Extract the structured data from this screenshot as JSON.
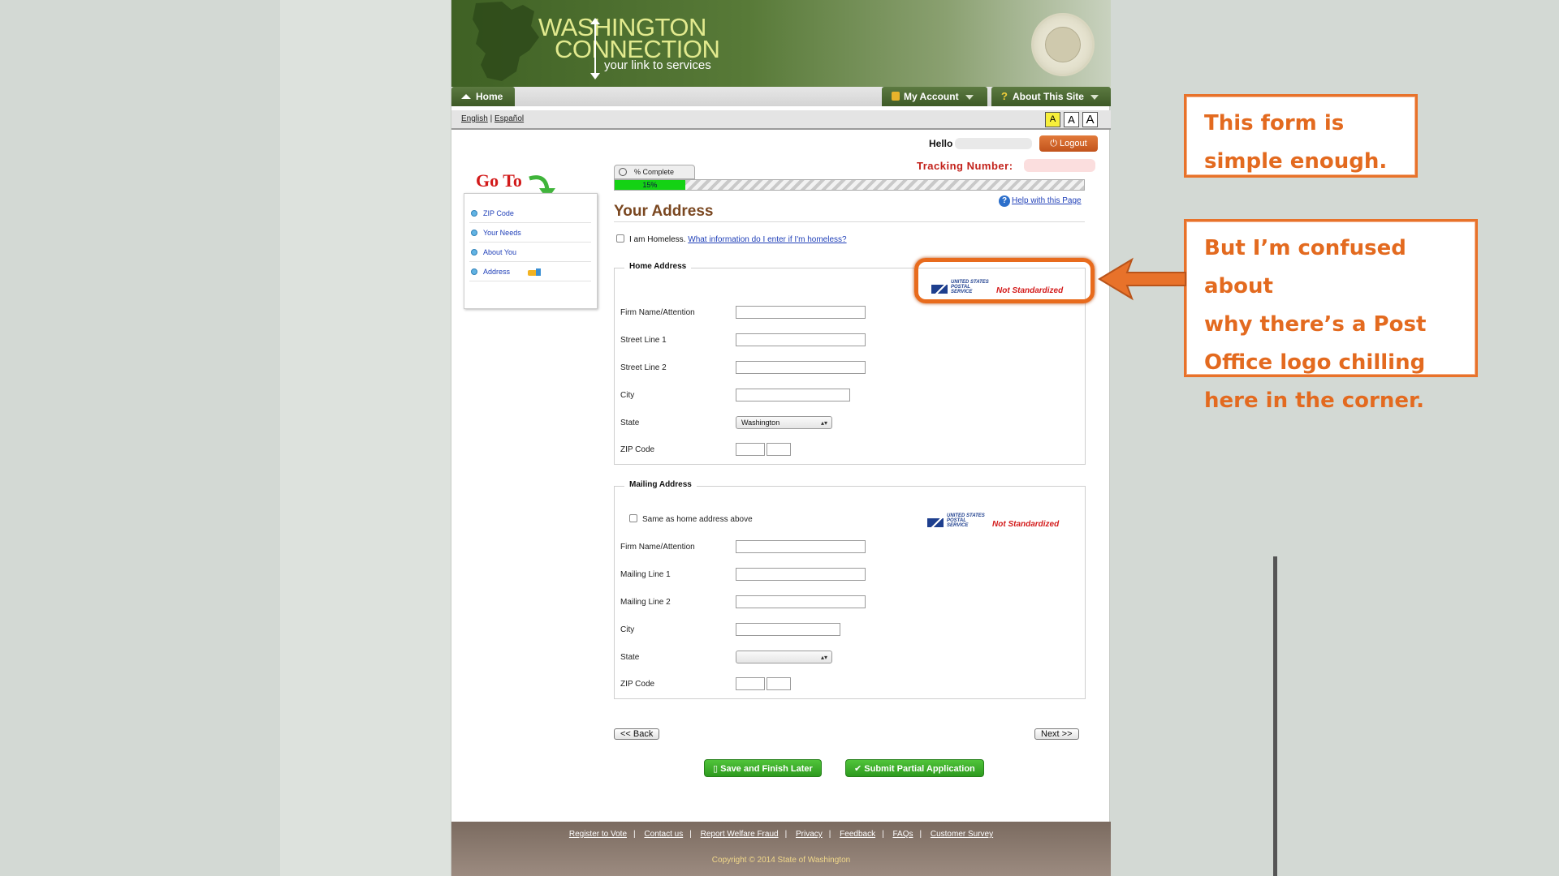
{
  "header": {
    "logo_line1": "WASHINGTON",
    "logo_line2": "CONNECTION",
    "tagline": "your link to services"
  },
  "nav": {
    "home": "Home",
    "my_account": "My Account",
    "about_site": "About This Site"
  },
  "language": {
    "english": "English",
    "separator": "|",
    "espanol": "Español"
  },
  "font_size_buttons": [
    "A",
    "A",
    "A"
  ],
  "user": {
    "hello": "Hello",
    "logout": "Logout",
    "tracking_label": "Tracking Number:"
  },
  "progress": {
    "label": "% Complete",
    "value_text": "15%",
    "value": 0.15
  },
  "sidebar": {
    "goto": "Go To",
    "items": [
      {
        "label": "ZIP Code"
      },
      {
        "label": "Your Needs"
      },
      {
        "label": "About You"
      },
      {
        "label": "Address"
      }
    ]
  },
  "page": {
    "title": "Your Address",
    "help_link": "Help with this Page",
    "homeless_label": "I am Homeless.",
    "homeless_link": "What information do I enter if I'm homeless?"
  },
  "home_address": {
    "legend": "Home Address",
    "usps_label": "UNITED STATES POSTAL SERVICE",
    "status": "Not Standardized",
    "fields": [
      {
        "label": "Firm Name/Attention",
        "value": ""
      },
      {
        "label": "Street Line 1",
        "value": ""
      },
      {
        "label": "Street Line 2",
        "value": ""
      },
      {
        "label": "City",
        "value": ""
      },
      {
        "label": "State",
        "value": "Washington"
      },
      {
        "label": "ZIP Code",
        "value": ""
      }
    ]
  },
  "mailing_address": {
    "legend": "Mailing Address",
    "same_as_label": "Same as home address above",
    "usps_label": "UNITED STATES POSTAL SERVICE",
    "status": "Not Standardized",
    "fields": [
      {
        "label": "Firm Name/Attention",
        "value": ""
      },
      {
        "label": "Mailing Line 1",
        "value": ""
      },
      {
        "label": "Mailing Line 2",
        "value": ""
      },
      {
        "label": "City",
        "value": ""
      },
      {
        "label": "State",
        "value": ""
      },
      {
        "label": "ZIP Code",
        "value": ""
      }
    ]
  },
  "buttons": {
    "back": "<< Back",
    "next": "Next >>",
    "save": "Save and Finish Later",
    "submit": "Submit Partial Application"
  },
  "footer": {
    "links": [
      "Register to Vote",
      "Contact us",
      "Report Welfare Fraud",
      "Privacy",
      "Feedback",
      "FAQs",
      "Customer Survey"
    ],
    "separator": "|",
    "copyright": "Copyright © 2014 State of Washington"
  },
  "annotations": {
    "callout1_line1": "This form is",
    "callout1_line2": "simple enough.",
    "callout2_line1": "But I’m confused about",
    "callout2_line2": "why there’s a Post",
    "callout2_line3": "Office logo chilling",
    "callout2_line4": "here in the corner."
  },
  "colors": {
    "accent_orange": "#e8722a",
    "header_green": "#4a6b2d",
    "title_brown": "#7a4720",
    "error_red": "#d31b1b",
    "progress_green": "#14d214"
  }
}
